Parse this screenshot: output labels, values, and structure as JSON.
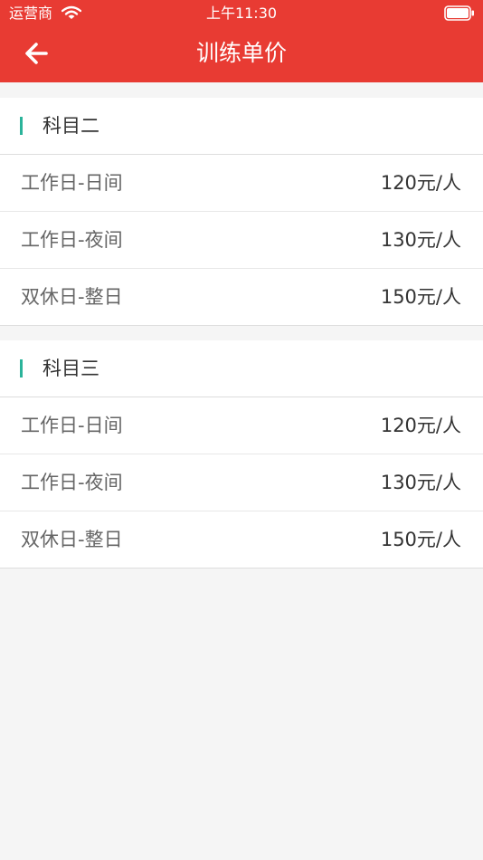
{
  "status_bar": {
    "carrier": "运营商",
    "time": "上午11:30"
  },
  "nav": {
    "title": "训练单价",
    "back_icon": "arrow-left-icon"
  },
  "colors": {
    "header_bg": "#e83b33",
    "accent": "#2bb39a",
    "page_bg": "#f5f5f5"
  },
  "sections": [
    {
      "title": "科目二",
      "rows": [
        {
          "label": "工作日-日间",
          "price": "120元/人"
        },
        {
          "label": "工作日-夜间",
          "price": "130元/人"
        },
        {
          "label": "双休日-整日",
          "price": "150元/人"
        }
      ]
    },
    {
      "title": "科目三",
      "rows": [
        {
          "label": "工作日-日间",
          "price": "120元/人"
        },
        {
          "label": "工作日-夜间",
          "price": "130元/人"
        },
        {
          "label": "双休日-整日",
          "price": "150元/人"
        }
      ]
    }
  ]
}
